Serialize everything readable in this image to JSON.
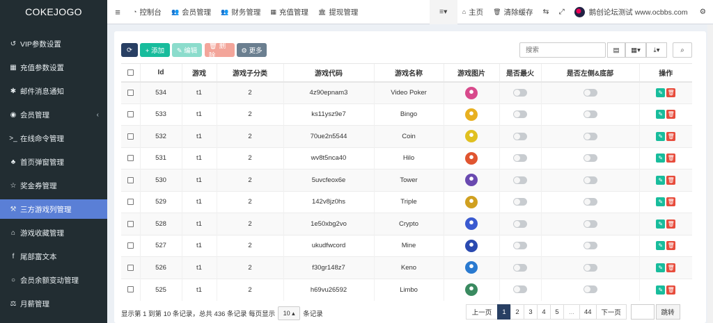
{
  "app": {
    "brand": "COKEJOGO"
  },
  "sidebar": {
    "items": [
      {
        "label": "VIP参数设置",
        "icon": "history-icon",
        "glyph": "↺"
      },
      {
        "label": "充值参数设置",
        "icon": "grid-icon",
        "glyph": "▦"
      },
      {
        "label": "邮件消息通知",
        "icon": "asterisk-icon",
        "glyph": "✱"
      },
      {
        "label": "会员管理",
        "icon": "user-circle-icon",
        "glyph": "◉",
        "arrow": "‹"
      },
      {
        "label": "在线命令管理",
        "icon": "terminal-icon",
        "glyph": ">_"
      },
      {
        "label": "首页弹窗管理",
        "icon": "bell-icon",
        "glyph": "♣"
      },
      {
        "label": "奖金券管理",
        "icon": "star-icon",
        "glyph": "☆"
      },
      {
        "label": "三方游戏列管理",
        "icon": "gavel-icon",
        "glyph": "⚒",
        "active": true
      },
      {
        "label": "游戏收藏管理",
        "icon": "folder-open-icon",
        "glyph": "⌂"
      },
      {
        "label": "尾部富文本",
        "icon": "facebook-icon",
        "glyph": "f"
      },
      {
        "label": "会员余额变动管理",
        "icon": "circle-icon",
        "glyph": "○"
      },
      {
        "label": "月薪管理",
        "icon": "balance-scale-icon",
        "glyph": "⚖"
      }
    ]
  },
  "navbar": {
    "toggle": "≡",
    "left": [
      {
        "label": "控制台",
        "icon": "dashboard-icon",
        "glyph": "◔"
      },
      {
        "label": "会员管理",
        "icon": "users-icon",
        "glyph": "👥"
      },
      {
        "label": "财务管理",
        "icon": "users-icon",
        "glyph": "👥"
      },
      {
        "label": "充值管理",
        "icon": "grid-icon",
        "glyph": "▦"
      },
      {
        "label": "提现管理",
        "icon": "bank-icon",
        "glyph": "🏛"
      }
    ],
    "right": {
      "menu_glyph": "≡▾",
      "home": "主页",
      "clear_cache": "清除缓存",
      "user": "鹅创论坛测试 www.ocbbs.com"
    }
  },
  "toolbar": {
    "refresh": "⟳",
    "add": "+ 添加",
    "edit": "✎ 编辑",
    "delete": "🗑 删除",
    "more": "⚙ 更多",
    "search_placeholder": "搜索"
  },
  "table": {
    "headers": [
      "Id",
      "游戏",
      "游戏子分类",
      "游戏代码",
      "游戏名称",
      "游戏图片",
      "是否最火",
      "是否左侧&底部",
      "操作"
    ],
    "rows": [
      {
        "id": "534",
        "game": "t1",
        "sub": "2",
        "code": "4z90epnam3",
        "name": "Video Poker",
        "color": "#d84a8c"
      },
      {
        "id": "533",
        "game": "t1",
        "sub": "2",
        "code": "ks11ysz9e7",
        "name": "Bingo",
        "color": "#e8b020"
      },
      {
        "id": "532",
        "game": "t1",
        "sub": "2",
        "code": "70ue2n5544",
        "name": "Coin",
        "color": "#e0c020"
      },
      {
        "id": "531",
        "game": "t1",
        "sub": "2",
        "code": "wv8t5nca40",
        "name": "Hilo",
        "color": "#e05530"
      },
      {
        "id": "530",
        "game": "t1",
        "sub": "2",
        "code": "5uvcfeox6e",
        "name": "Tower",
        "color": "#6a4ab0"
      },
      {
        "id": "529",
        "game": "t1",
        "sub": "2",
        "code": "142v8jz0hs",
        "name": "Triple",
        "color": "#d0a020"
      },
      {
        "id": "528",
        "game": "t1",
        "sub": "2",
        "code": "1e50xbg2vo",
        "name": "Crypto",
        "color": "#3a5ad0"
      },
      {
        "id": "527",
        "game": "t1",
        "sub": "2",
        "code": "ukudfwcord",
        "name": "Mine",
        "color": "#2a4ab0"
      },
      {
        "id": "526",
        "game": "t1",
        "sub": "2",
        "code": "f30gr148z7",
        "name": "Keno",
        "color": "#2a7ad0"
      },
      {
        "id": "525",
        "game": "t1",
        "sub": "2",
        "code": "h69vu26592",
        "name": "Limbo",
        "color": "#3a8a60"
      }
    ]
  },
  "pagination": {
    "info_prefix": "显示第 1 到第 10 条记录，总共 436 条记录 每页显示",
    "page_size": "10 ▴",
    "info_suffix": "条记录",
    "prev": "上一页",
    "pages": [
      "1",
      "2",
      "3",
      "4",
      "5",
      "...",
      "44"
    ],
    "next": "下一页",
    "jump": "跳转"
  }
}
